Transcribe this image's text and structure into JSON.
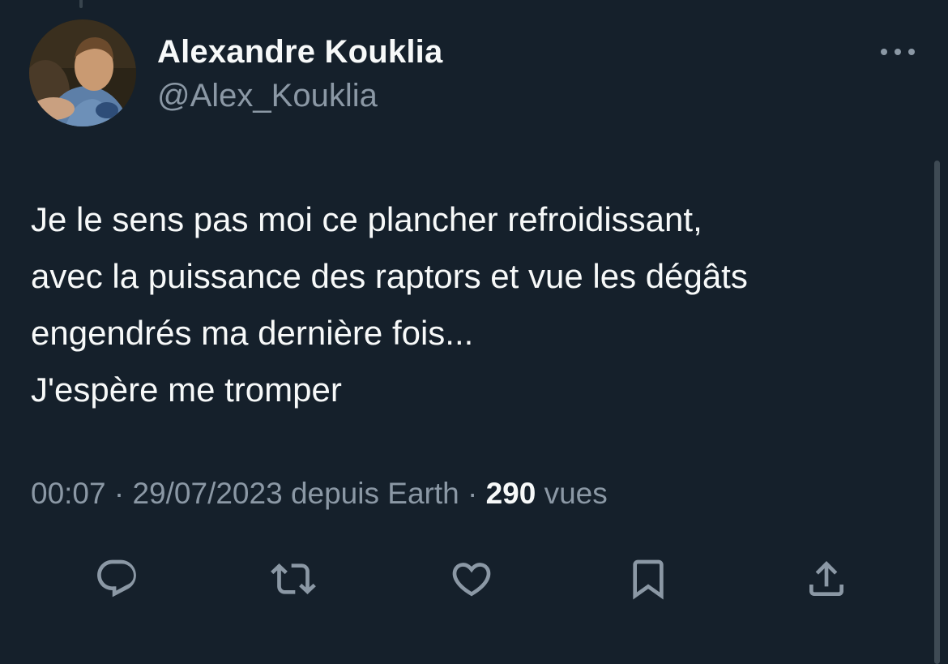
{
  "tweet": {
    "author": {
      "display_name": "Alexandre Kouklia",
      "handle": "@Alex_Kouklia"
    },
    "text_lines": [
      "Je le sens pas moi ce plancher refroidissant,",
      "avec la puissance des raptors et vue les dégâts",
      "engendrés ma dernière fois...",
      "J'espère me tromper"
    ],
    "meta": {
      "time": "00:07",
      "separator": "·",
      "date": "29/07/2023",
      "source": "depuis Earth",
      "views_count": "290",
      "views_label": "vues"
    }
  },
  "actions": [
    {
      "name": "reply",
      "icon": "reply-icon"
    },
    {
      "name": "retweet",
      "icon": "retweet-icon"
    },
    {
      "name": "like",
      "icon": "heart-icon"
    },
    {
      "name": "bookmark",
      "icon": "bookmark-icon"
    },
    {
      "name": "share",
      "icon": "share-icon"
    }
  ],
  "colors": {
    "background": "#15202b",
    "primary_text": "#f7f9f9",
    "secondary_text": "#8b98a5",
    "icon": "#8b98a5"
  }
}
